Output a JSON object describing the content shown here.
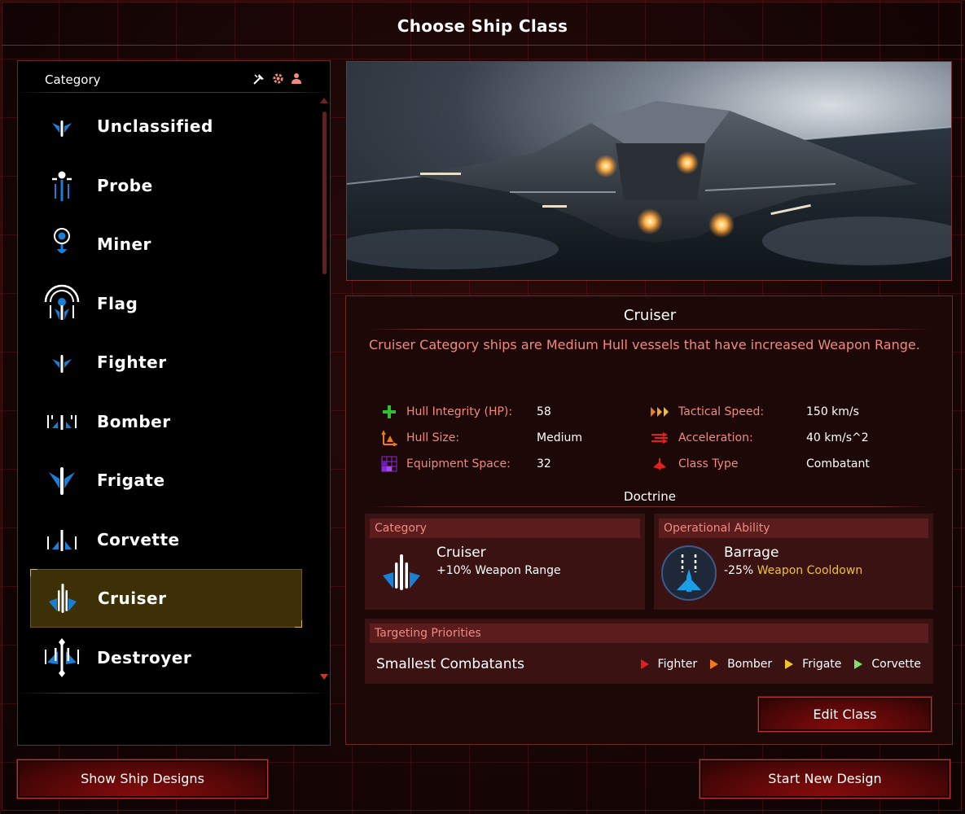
{
  "title": "Choose Ship Class",
  "category_panel": {
    "header": "Category",
    "header_icons": [
      "tools-icon",
      "gear-icon",
      "crew-icon"
    ],
    "items": [
      {
        "label": "Unclassified",
        "icon": "unclassified-ship-icon"
      },
      {
        "label": "Probe",
        "icon": "probe-ship-icon"
      },
      {
        "label": "Miner",
        "icon": "miner-ship-icon"
      },
      {
        "label": "Flag",
        "icon": "flag-ship-icon"
      },
      {
        "label": "Fighter",
        "icon": "fighter-ship-icon"
      },
      {
        "label": "Bomber",
        "icon": "bomber-ship-icon"
      },
      {
        "label": "Frigate",
        "icon": "frigate-ship-icon"
      },
      {
        "label": "Corvette",
        "icon": "corvette-ship-icon"
      },
      {
        "label": "Cruiser",
        "icon": "cruiser-ship-icon",
        "selected": true
      },
      {
        "label": "Destroyer",
        "icon": "destroyer-ship-icon"
      }
    ]
  },
  "detail": {
    "name": "Cruiser",
    "description": "Cruiser Category ships are Medium Hull vessels that have increased Weapon Range.",
    "stats_left": [
      {
        "label": "Hull Integrity (HP):",
        "value": "58",
        "icon": "hull-integrity-icon"
      },
      {
        "label": "Hull Size:",
        "value": "Medium",
        "icon": "hull-size-icon"
      },
      {
        "label": "Equipment Space:",
        "value": "32",
        "icon": "equipment-space-icon"
      }
    ],
    "stats_right": [
      {
        "label": "Tactical Speed:",
        "value": "150 km/s",
        "icon": "tactical-speed-icon"
      },
      {
        "label": "Acceleration:",
        "value": "40 km/s^2",
        "icon": "acceleration-icon"
      },
      {
        "label": "Class Type",
        "value": "Combatant",
        "icon": "class-type-icon"
      }
    ],
    "doctrine_title": "Doctrine",
    "category_box": {
      "header": "Category",
      "name": "Cruiser",
      "bonus": "+10% Weapon Range"
    },
    "ability_box": {
      "header": "Operational Ability",
      "name": "Barrage",
      "bonus_value": "-25%",
      "bonus_label": "Weapon Cooldown"
    },
    "targeting": {
      "header": "Targeting Priorities",
      "label": "Smallest Combatants",
      "priorities": [
        {
          "name": "Fighter",
          "color": "#e02020"
        },
        {
          "name": "Bomber",
          "color": "#f07a1a"
        },
        {
          "name": "Frigate",
          "color": "#f2c12e"
        },
        {
          "name": "Corvette",
          "color": "#7ee070"
        }
      ]
    },
    "edit_button": "Edit Class"
  },
  "buttons": {
    "show_designs": "Show Ship Designs",
    "new_design": "Start New Design"
  },
  "colors": {
    "accent_text": "#f08a80",
    "selected_bg": "#3d2f06",
    "ship_blue": "#1a7fd6",
    "highlight_yellow": "#f2c12e"
  }
}
